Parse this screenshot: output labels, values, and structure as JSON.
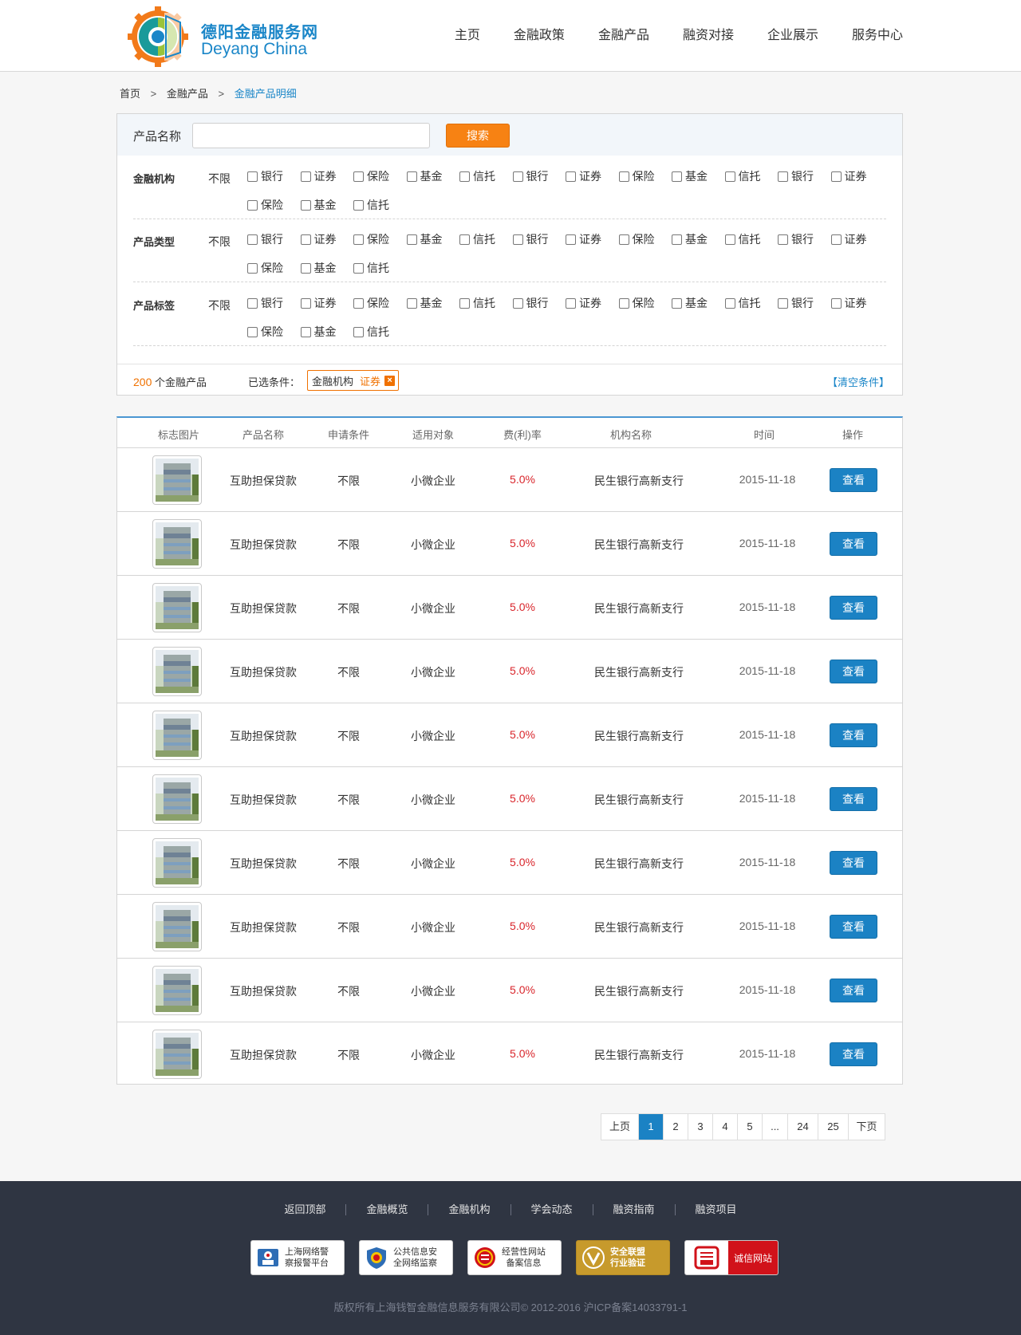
{
  "header": {
    "logo_cn": "德阳金融服务网",
    "logo_en": "Deyang China",
    "nav": [
      "主页",
      "金融政策",
      "金融产品",
      "融资对接",
      "企业展示",
      "服务中心"
    ]
  },
  "breadcrumb": {
    "items": [
      "首页",
      "金融产品",
      "金融产品明细"
    ],
    "separator": ">"
  },
  "search": {
    "label": "产品名称",
    "value": "",
    "placeholder": "",
    "button": "搜索"
  },
  "filters": [
    {
      "title": "金融机构",
      "any": "不限",
      "options": [
        "银行",
        "证券",
        "保险",
        "基金",
        "信托",
        "银行",
        "证券",
        "保险",
        "基金",
        "信托",
        "银行",
        "证券",
        "保险",
        "基金",
        "信托"
      ]
    },
    {
      "title": "产品类型",
      "any": "不限",
      "options": [
        "银行",
        "证券",
        "保险",
        "基金",
        "信托",
        "银行",
        "证券",
        "保险",
        "基金",
        "信托",
        "银行",
        "证券",
        "保险",
        "基金",
        "信托"
      ]
    },
    {
      "title": "产品标签",
      "any": "不限",
      "options": [
        "银行",
        "证券",
        "保险",
        "基金",
        "信托",
        "银行",
        "证券",
        "保险",
        "基金",
        "信托",
        "银行",
        "证券",
        "保险",
        "基金",
        "信托"
      ]
    }
  ],
  "result": {
    "count": "200",
    "count_suffix": "个金融产品",
    "selected_label": "已选条件：",
    "selected_tag": {
      "key": "金融机构",
      "value": "证券",
      "remove_icon": "×"
    },
    "clear": "【清空条件】"
  },
  "table": {
    "headers": [
      "标志图片",
      "产品名称",
      "申请条件",
      "适用对象",
      "费(利)率",
      "机构名称",
      "时间",
      "操作"
    ],
    "rows": [
      {
        "name": "互助担保贷款",
        "condition": "不限",
        "target": "小微企业",
        "rate": "5.0%",
        "org": "民生银行高新支行",
        "date": "2015-11-18",
        "action": "查看"
      },
      {
        "name": "互助担保贷款",
        "condition": "不限",
        "target": "小微企业",
        "rate": "5.0%",
        "org": "民生银行高新支行",
        "date": "2015-11-18",
        "action": "查看"
      },
      {
        "name": "互助担保贷款",
        "condition": "不限",
        "target": "小微企业",
        "rate": "5.0%",
        "org": "民生银行高新支行",
        "date": "2015-11-18",
        "action": "查看"
      },
      {
        "name": "互助担保贷款",
        "condition": "不限",
        "target": "小微企业",
        "rate": "5.0%",
        "org": "民生银行高新支行",
        "date": "2015-11-18",
        "action": "查看"
      },
      {
        "name": "互助担保贷款",
        "condition": "不限",
        "target": "小微企业",
        "rate": "5.0%",
        "org": "民生银行高新支行",
        "date": "2015-11-18",
        "action": "查看"
      },
      {
        "name": "互助担保贷款",
        "condition": "不限",
        "target": "小微企业",
        "rate": "5.0%",
        "org": "民生银行高新支行",
        "date": "2015-11-18",
        "action": "查看"
      },
      {
        "name": "互助担保贷款",
        "condition": "不限",
        "target": "小微企业",
        "rate": "5.0%",
        "org": "民生银行高新支行",
        "date": "2015-11-18",
        "action": "查看"
      },
      {
        "name": "互助担保贷款",
        "condition": "不限",
        "target": "小微企业",
        "rate": "5.0%",
        "org": "民生银行高新支行",
        "date": "2015-11-18",
        "action": "查看"
      },
      {
        "name": "互助担保贷款",
        "condition": "不限",
        "target": "小微企业",
        "rate": "5.0%",
        "org": "民生银行高新支行",
        "date": "2015-11-18",
        "action": "查看"
      },
      {
        "name": "互助担保贷款",
        "condition": "不限",
        "target": "小微企业",
        "rate": "5.0%",
        "org": "民生银行高新支行",
        "date": "2015-11-18",
        "action": "查看"
      }
    ]
  },
  "pagination": {
    "prev": "上页",
    "pages": [
      "1",
      "2",
      "3",
      "4",
      "5",
      "...",
      "24",
      "25"
    ],
    "current": "1",
    "next": "下页"
  },
  "footer": {
    "links": [
      "返回顶部",
      "金融概览",
      "金融机构",
      "学会动态",
      "融资指南",
      "融资项目"
    ],
    "badges": [
      {
        "text": "上海网络警\n察报警平台",
        "icon": "police-icon"
      },
      {
        "text": "公共信息安\n全网络监察",
        "icon": "shield-icon"
      },
      {
        "text": "经营性网站\n备案信息",
        "icon": "seal-icon"
      },
      {
        "text": "安全联盟\n行业验证",
        "icon": "v-icon"
      },
      {
        "text": "诚信网站",
        "icon": "credit-icon"
      }
    ],
    "copyright": "版权所有上海钱智金融信息服务有限公司© 2012-2016 沪ICP备案14033791-1"
  },
  "colors": {
    "brand_blue": "#1a86c8",
    "search_orange": "#f78213",
    "rate_red": "#d9262c",
    "footer_bg": "#2f3542"
  }
}
